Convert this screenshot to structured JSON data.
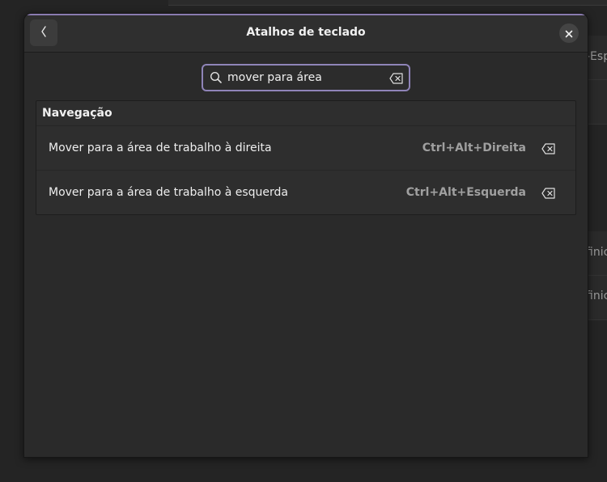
{
  "dialog": {
    "title": "Atalhos de teclado",
    "back_icon": "chevron-left-icon",
    "close_icon": "close-icon"
  },
  "search": {
    "value": "mover para área",
    "placeholder": "",
    "search_icon": "search-icon",
    "clear_icon": "backspace-clear-icon"
  },
  "list": {
    "section_title": "Navegação",
    "rows": [
      {
        "label": "Mover para a área de trabalho à direita",
        "accel": "Ctrl+Alt+Direita",
        "reset_icon": "backspace-clear-icon"
      },
      {
        "label": "Mover para a área de trabalho à esquerda",
        "accel": "Ctrl+Alt+Esquerda",
        "reset_icon": "backspace-clear-icon"
      }
    ]
  },
  "background": {
    "peek_texts": [
      "-Esp",
      "finic",
      "finic"
    ]
  },
  "colors": {
    "accent": "#8f84b8",
    "dialog_bg": "#2a2a2a",
    "list_bg": "#2e2e2e"
  }
}
